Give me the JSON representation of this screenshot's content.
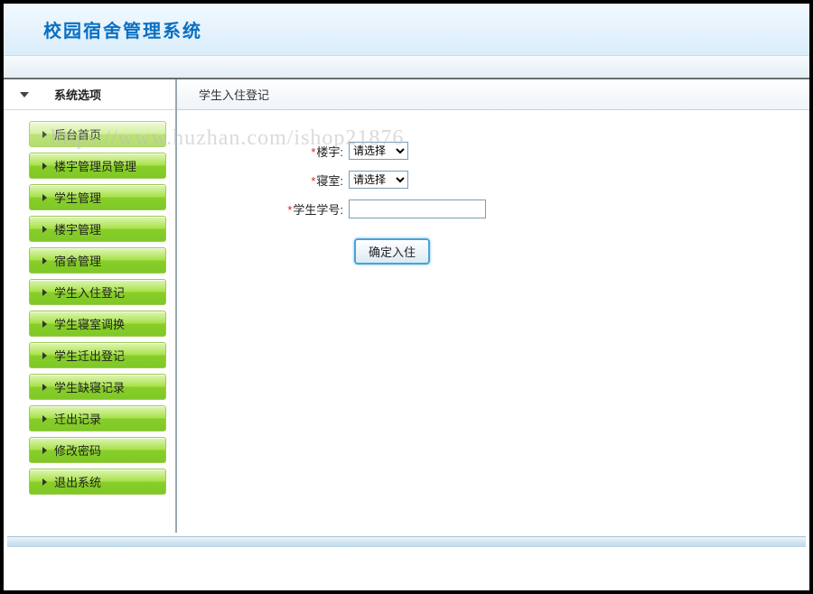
{
  "header": {
    "title": "校园宿舍管理系统"
  },
  "sidebar": {
    "title": "系统选项",
    "items": [
      {
        "label": "后台首页"
      },
      {
        "label": "楼宇管理员管理"
      },
      {
        "label": "学生管理"
      },
      {
        "label": "楼宇管理"
      },
      {
        "label": "宿舍管理"
      },
      {
        "label": "学生入住登记"
      },
      {
        "label": "学生寝室调换"
      },
      {
        "label": "学生迁出登记"
      },
      {
        "label": "学生缺寝记录"
      },
      {
        "label": "迁出记录"
      },
      {
        "label": "修改密码"
      },
      {
        "label": "退出系统"
      }
    ]
  },
  "content": {
    "page_title": "学生入住登记",
    "form": {
      "building_label": "楼宇:",
      "building_selected": "请选择",
      "room_label": "寝室:",
      "room_selected": "请选择",
      "student_id_label": "学生学号:",
      "student_id_value": "",
      "submit_label": "确定入住"
    }
  },
  "watermark": "https://www.huzhan.com/ishop21876"
}
